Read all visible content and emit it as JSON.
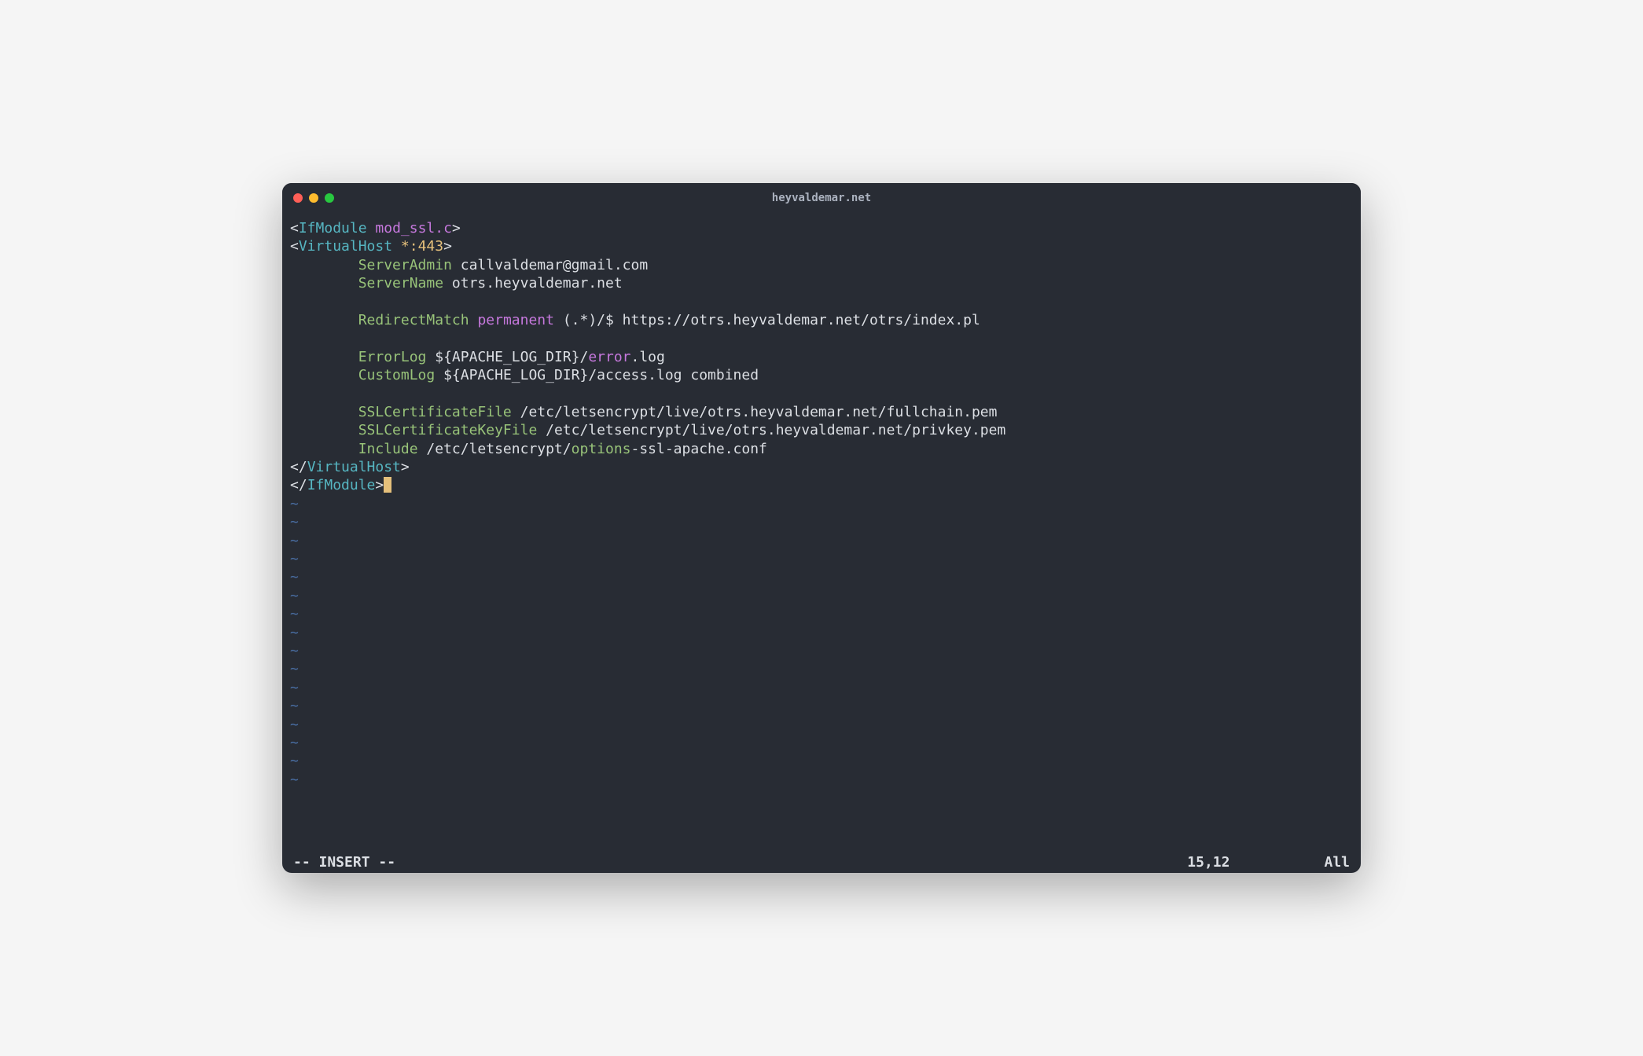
{
  "window": {
    "title": "heyvaldemar.net"
  },
  "editor": {
    "lines": [
      {
        "segments": [
          {
            "t": "<",
            "c": "c-white"
          },
          {
            "t": "IfModule",
            "c": "c-cyan"
          },
          {
            "t": " ",
            "c": "c-white"
          },
          {
            "t": "mod_ssl.c",
            "c": "c-magenta"
          },
          {
            "t": ">",
            "c": "c-white"
          }
        ]
      },
      {
        "segments": [
          {
            "t": "<",
            "c": "c-white"
          },
          {
            "t": "VirtualHost",
            "c": "c-cyan"
          },
          {
            "t": " ",
            "c": "c-white"
          },
          {
            "t": "*:443",
            "c": "c-yellow"
          },
          {
            "t": ">",
            "c": "c-white"
          }
        ]
      },
      {
        "segments": [
          {
            "t": "        ",
            "c": "c-white"
          },
          {
            "t": "ServerAdmin",
            "c": "c-green"
          },
          {
            "t": " callvaldemar@gmail.com",
            "c": "c-white"
          }
        ]
      },
      {
        "segments": [
          {
            "t": "        ",
            "c": "c-white"
          },
          {
            "t": "ServerName",
            "c": "c-green"
          },
          {
            "t": " otrs.heyvaldemar.net",
            "c": "c-white"
          }
        ]
      },
      {
        "segments": [
          {
            "t": "",
            "c": "c-white"
          }
        ]
      },
      {
        "segments": [
          {
            "t": "        ",
            "c": "c-white"
          },
          {
            "t": "RedirectMatch",
            "c": "c-green"
          },
          {
            "t": " ",
            "c": "c-white"
          },
          {
            "t": "permanent",
            "c": "c-magenta"
          },
          {
            "t": " (.*)/$ https://otrs.heyvaldemar.net/otrs/index.pl",
            "c": "c-white"
          }
        ]
      },
      {
        "segments": [
          {
            "t": "",
            "c": "c-white"
          }
        ]
      },
      {
        "segments": [
          {
            "t": "        ",
            "c": "c-white"
          },
          {
            "t": "ErrorLog",
            "c": "c-green"
          },
          {
            "t": " ${APACHE_LOG_DIR}/",
            "c": "c-white"
          },
          {
            "t": "error",
            "c": "c-magenta"
          },
          {
            "t": ".log",
            "c": "c-white"
          }
        ]
      },
      {
        "segments": [
          {
            "t": "        ",
            "c": "c-white"
          },
          {
            "t": "CustomLog",
            "c": "c-green"
          },
          {
            "t": " ${APACHE_LOG_DIR}/access.log combined",
            "c": "c-white"
          }
        ]
      },
      {
        "segments": [
          {
            "t": "",
            "c": "c-white"
          }
        ]
      },
      {
        "segments": [
          {
            "t": "        ",
            "c": "c-white"
          },
          {
            "t": "SSLCertificateFile",
            "c": "c-green"
          },
          {
            "t": " /etc/letsencrypt/live/otrs.heyvaldemar.net/fullchain.pem",
            "c": "c-white"
          }
        ]
      },
      {
        "segments": [
          {
            "t": "        ",
            "c": "c-white"
          },
          {
            "t": "SSLCertificateKeyFile",
            "c": "c-green"
          },
          {
            "t": " /etc/letsencrypt/live/otrs.heyvaldemar.net/privkey.pem",
            "c": "c-white"
          }
        ]
      },
      {
        "segments": [
          {
            "t": "        ",
            "c": "c-white"
          },
          {
            "t": "Include",
            "c": "c-green"
          },
          {
            "t": " /etc/letsencrypt/",
            "c": "c-white"
          },
          {
            "t": "options",
            "c": "c-green"
          },
          {
            "t": "-ssl-apache.conf",
            "c": "c-white"
          }
        ]
      },
      {
        "segments": [
          {
            "t": "</",
            "c": "c-white"
          },
          {
            "t": "VirtualHost",
            "c": "c-cyan"
          },
          {
            "t": ">",
            "c": "c-white"
          }
        ]
      },
      {
        "segments": [
          {
            "t": "</",
            "c": "c-white"
          },
          {
            "t": "IfModule",
            "c": "c-cyan"
          },
          {
            "t": ">",
            "c": "c-white"
          }
        ],
        "cursor": true
      }
    ],
    "tilde_count": 16,
    "tilde_char": "~"
  },
  "status": {
    "mode": "-- INSERT --",
    "position": "15,12",
    "scroll": "All"
  }
}
